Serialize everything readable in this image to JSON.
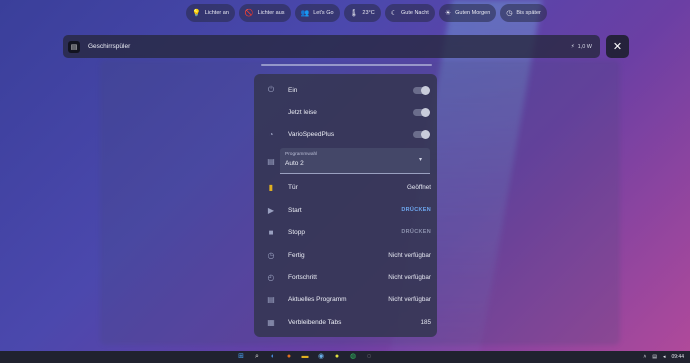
{
  "chips": [
    {
      "icon": "lightbulb-icon",
      "glyph": "💡",
      "label": "Lichter an"
    },
    {
      "icon": "lightbulb-off-icon",
      "glyph": "🚫",
      "label": "Lichter aus"
    },
    {
      "icon": "group-icon",
      "glyph": "👥",
      "label": "Let's Go"
    },
    {
      "icon": "thermometer-icon",
      "glyph": "🌡",
      "label": "23°C"
    },
    {
      "icon": "moon-icon",
      "glyph": "☾",
      "label": "Gute Nacht"
    },
    {
      "icon": "sun-icon",
      "glyph": "☀",
      "label": "Guten Morgen"
    },
    {
      "icon": "clock-icon",
      "glyph": "◷",
      "label": "Bis später"
    }
  ],
  "header": {
    "title": "Geschirrspüler",
    "power_icon": "bolt-icon",
    "power_glyph": "⚡",
    "power_value": "1,0 W"
  },
  "close_glyph": "✕",
  "panel": {
    "rows_top": [
      {
        "icon": "power-icon",
        "glyph": "⏻",
        "label": "Ein",
        "type": "toggle"
      },
      {
        "icon": "quiet-icon",
        "glyph": "",
        "label": "Jetzt leise",
        "type": "toggle"
      },
      {
        "icon": "speedometer-icon",
        "glyph": "◔",
        "label": "VarioSpeedPlus",
        "type": "toggle"
      }
    ],
    "select": {
      "icon": "dishwasher-icon",
      "glyph": "▤",
      "label": "Programmwahl",
      "value": "Auto 2",
      "caret": "▾"
    },
    "rows_bottom": [
      {
        "icon": "door-icon",
        "glyph": "▮",
        "label": "Tür",
        "value": "Geöffnet"
      },
      {
        "icon": "play-icon",
        "glyph": "▶",
        "label": "Start",
        "action": "DRÜCKEN"
      },
      {
        "icon": "stop-icon",
        "glyph": "■",
        "label": "Stopp",
        "action": "DRÜCKEN"
      },
      {
        "icon": "history-icon",
        "glyph": "◷",
        "label": "Fertig",
        "value": "Nicht verfügbar"
      },
      {
        "icon": "progress-icon",
        "glyph": "◴",
        "label": "Fortschritt",
        "value": "Nicht verfügbar"
      },
      {
        "icon": "dishwasher-icon",
        "glyph": "▤",
        "label": "Aktuelles Programm",
        "value": "Nicht verfügbar"
      },
      {
        "icon": "tabs-icon",
        "glyph": "▦",
        "label": "Verbleibende Tabs",
        "value": "185"
      }
    ]
  },
  "taskbar": {
    "time": "09:44"
  },
  "colors": {
    "toggle_off": "#c9ccdb",
    "action_active": "#6ea8f0",
    "action_disabled": "#8c91ad"
  }
}
